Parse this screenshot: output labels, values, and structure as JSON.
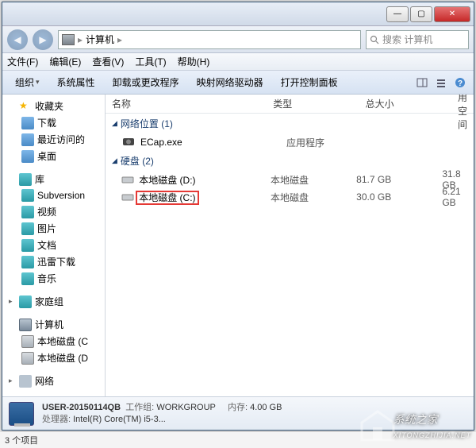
{
  "titlebar": {
    "min": "—",
    "max": "▢",
    "close": "✕"
  },
  "nav": {
    "breadcrumb_icon": "computer",
    "breadcrumb": "计算机",
    "sep": "▸",
    "search_placeholder": "搜索 计算机"
  },
  "menubar": [
    "文件(F)",
    "编辑(E)",
    "查看(V)",
    "工具(T)",
    "帮助(H)"
  ],
  "toolbar": {
    "items": [
      "组织",
      "系统属性",
      "卸载或更改程序",
      "映射网络驱动器",
      "打开控制面板"
    ]
  },
  "columns": {
    "name": "名称",
    "type": "类型",
    "size": "总大小",
    "free": "可用空间"
  },
  "sidebar": {
    "favorites": {
      "label": "收藏夹",
      "items": [
        "下载",
        "最近访问的",
        "桌面"
      ]
    },
    "libraries": {
      "label": "库",
      "items": [
        "Subversion",
        "视频",
        "图片",
        "文档",
        "迅雷下载",
        "音乐"
      ]
    },
    "homegroup": {
      "label": "家庭组"
    },
    "computer": {
      "label": "计算机",
      "items": [
        "本地磁盘 (C",
        "本地磁盘 (D"
      ]
    },
    "network": {
      "label": "网络"
    }
  },
  "content": {
    "groups": [
      {
        "title": "网络位置 (1)",
        "rows": [
          {
            "icon": "camera",
            "name": "ECap.exe",
            "type": "应用程序",
            "size": "",
            "free": ""
          }
        ]
      },
      {
        "title": "硬盘 (2)",
        "rows": [
          {
            "icon": "drive",
            "name": "本地磁盘 (D:)",
            "type": "本地磁盘",
            "size": "81.7 GB",
            "free": "31.8 GB"
          },
          {
            "icon": "drive",
            "name": "本地磁盘 (C:)",
            "type": "本地磁盘",
            "size": "30.0 GB",
            "free": "6.21 GB",
            "highlight": true
          }
        ]
      }
    ]
  },
  "details": {
    "computer_name": "USER-20150114QB",
    "workgroup_label": "工作组:",
    "workgroup": "WORKGROUP",
    "memory_label": "内存:",
    "memory": "4.00 GB",
    "cpu_label": "处理器:",
    "cpu": "Intel(R) Core(TM) i5-3..."
  },
  "statusbar": "3 个项目",
  "watermark": "系统之家"
}
